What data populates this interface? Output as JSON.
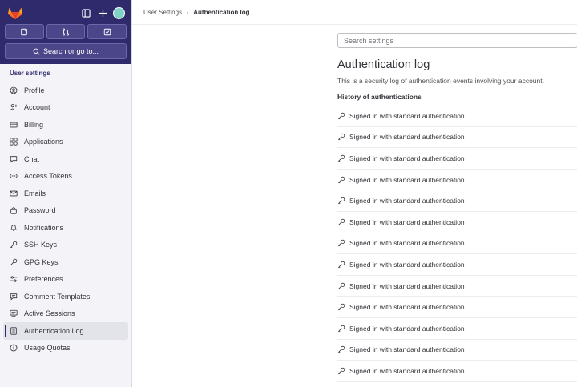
{
  "sidebar": {
    "top_icons": [
      "gitlab-logo",
      "sidebar-toggle-icon",
      "plus-icon",
      "avatar"
    ],
    "quick_actions": [
      "issues-icon",
      "merge-request-icon",
      "todo-icon"
    ],
    "search_label": "Search or go to...",
    "section_title": "User settings",
    "items": [
      {
        "label": "Profile",
        "icon": "profile-icon"
      },
      {
        "label": "Account",
        "icon": "account-icon"
      },
      {
        "label": "Billing",
        "icon": "billing-icon"
      },
      {
        "label": "Applications",
        "icon": "applications-icon"
      },
      {
        "label": "Chat",
        "icon": "chat-icon"
      },
      {
        "label": "Access Tokens",
        "icon": "token-icon"
      },
      {
        "label": "Emails",
        "icon": "mail-icon"
      },
      {
        "label": "Password",
        "icon": "lock-icon"
      },
      {
        "label": "Notifications",
        "icon": "bell-icon"
      },
      {
        "label": "SSH Keys",
        "icon": "key-icon"
      },
      {
        "label": "GPG Keys",
        "icon": "key-icon"
      },
      {
        "label": "Preferences",
        "icon": "preferences-icon"
      },
      {
        "label": "Comment Templates",
        "icon": "comment-icon"
      },
      {
        "label": "Active Sessions",
        "icon": "sessions-icon"
      },
      {
        "label": "Authentication Log",
        "icon": "log-icon",
        "active": true
      },
      {
        "label": "Usage Quotas",
        "icon": "quota-icon"
      }
    ]
  },
  "breadcrumb": {
    "parent": "User Settings",
    "separator": "/",
    "current": "Authentication log"
  },
  "main": {
    "search_placeholder": "Search settings",
    "title": "Authentication log",
    "description": "This is a security log of authentication events involving your account.",
    "history_heading": "History of authentications",
    "entries": [
      "Signed in with standard authentication",
      "Signed in with standard authentication",
      "Signed in with standard authentication",
      "Signed in with standard authentication",
      "Signed in with standard authentication",
      "Signed in with standard authentication",
      "Signed in with standard authentication",
      "Signed in with standard authentication",
      "Signed in with standard authentication",
      "Signed in with standard authentication",
      "Signed in with standard authentication",
      "Signed in with standard authentication",
      "Signed in with standard authentication"
    ]
  },
  "colors": {
    "sidebar_header": "#2f2a6b",
    "sidebar_bg": "#f4f4f8",
    "logo_orange": "#e24329"
  }
}
